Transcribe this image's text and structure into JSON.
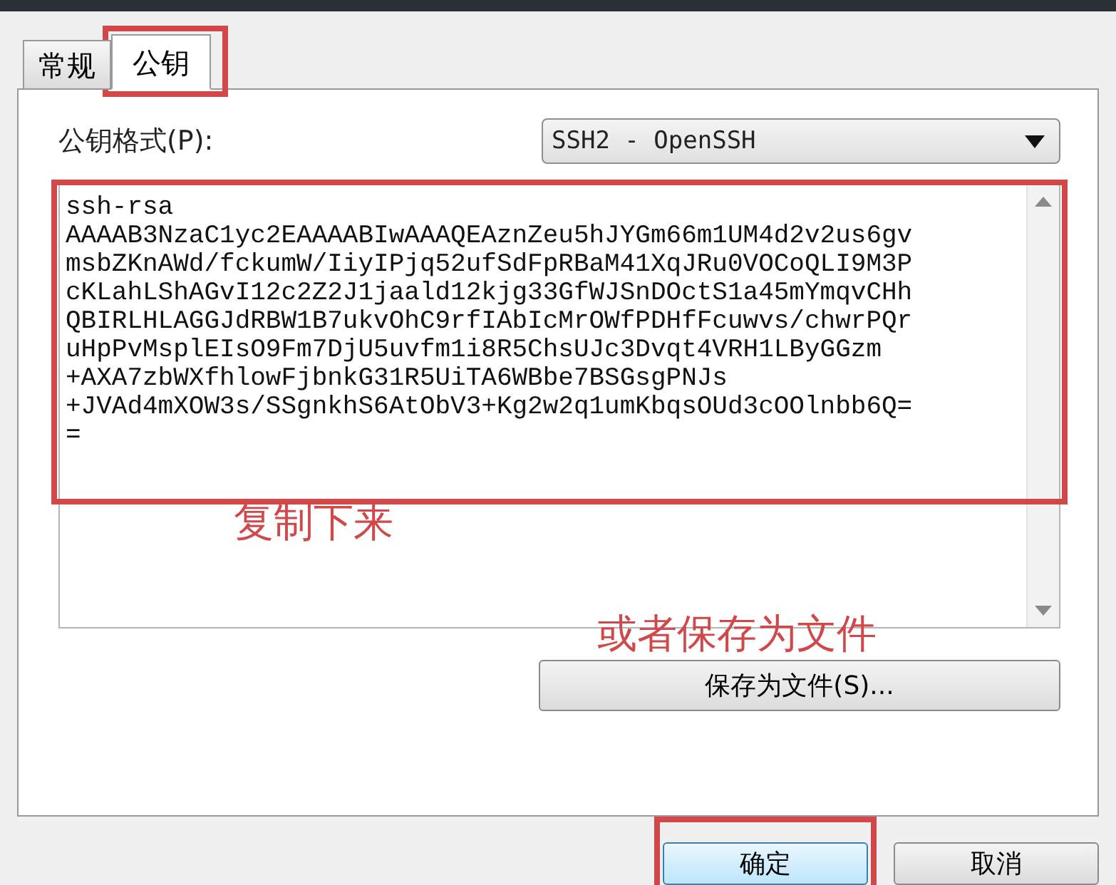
{
  "tabs": [
    {
      "label": "常规",
      "selected": false,
      "highlighted": false
    },
    {
      "label": "公钥",
      "selected": true,
      "highlighted": true
    }
  ],
  "format": {
    "label": "公钥格式(P):",
    "value": "SSH2 - OpenSSH"
  },
  "key_area": {
    "highlighted": true,
    "lines": [
      "ssh-rsa",
      "AAAAB3NzaC1yc2EAAAABIwAAAQEAznZeu5hJYGm66m1UM4d2v2us6gv",
      "msbZKnAWd/fckumW/IiyIPjq52ufSdFpRBaM41XqJRu0VOCoQLI9M3P",
      "cKLahLShAGvI12c2Z2J1jaald12kjg33GfWJSnDOctS1a45mYmqvCHh",
      "QBIRLHLAGGJdRBW1B7ukvOhC9rfIAbIcMrOWfPDHfFcuwvs/chwrPQr",
      "uHpPvMsplEIsO9Fm7DjU5uvfm1i8R5ChsUJc3Dvqt4VRH1LByGGzm",
      "+AXA7zbWXfhlowFjbnkG31R5UiTA6WBbe7BSGsgPNJs",
      "+JVAd4mXOW3s/SSgnkhS6AtObV3+Kg2w2q1umKbqsOUd3cOOlnbb6Q=",
      "="
    ]
  },
  "annotations": [
    {
      "text": "复制下来"
    },
    {
      "text": "或者保存为文件"
    }
  ],
  "save_button": {
    "label": "保存为文件(S)..."
  },
  "buttons": [
    {
      "label": "确定",
      "highlighted": true
    },
    {
      "label": "取消"
    }
  ]
}
